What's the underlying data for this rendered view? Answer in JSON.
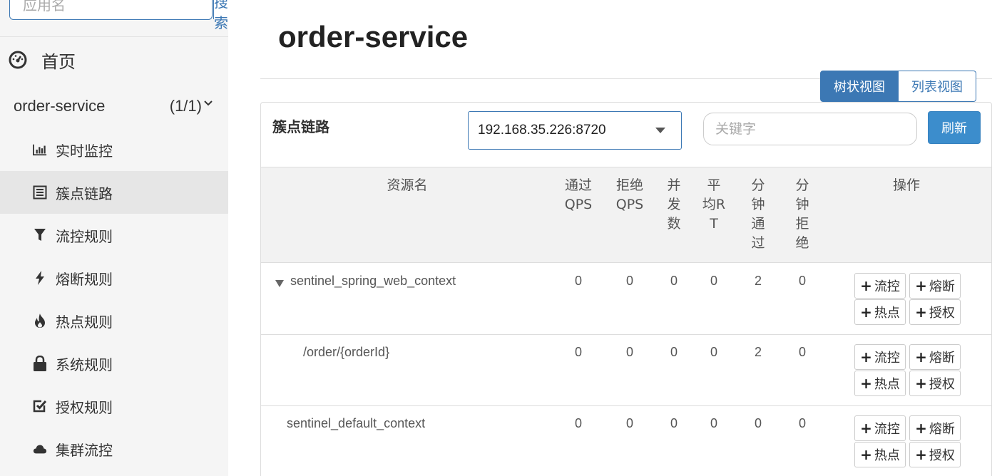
{
  "sidebar": {
    "search_placeholder": "应用名",
    "search_button": "搜索",
    "home_label": "首页",
    "app": {
      "name": "order-service",
      "count": "(1/1)"
    },
    "menu": [
      {
        "label": "实时监控",
        "icon": "bar-chart-icon"
      },
      {
        "label": "簇点链路",
        "icon": "list-icon",
        "active": true
      },
      {
        "label": "流控规则",
        "icon": "filter-icon"
      },
      {
        "label": "熔断规则",
        "icon": "lightning-icon"
      },
      {
        "label": "热点规则",
        "icon": "fire-icon"
      },
      {
        "label": "系统规则",
        "icon": "lock-icon"
      },
      {
        "label": "授权规则",
        "icon": "check-square-icon"
      },
      {
        "label": "集群流控",
        "icon": "cloud-icon"
      }
    ]
  },
  "main": {
    "title": "order-service",
    "view_tree": "树状视图",
    "view_list": "列表视图",
    "panel_title": "簇点链路",
    "machine": "192.168.35.226:8720",
    "keyword_placeholder": "关键字",
    "refresh": "刷新"
  },
  "table": {
    "headers": {
      "resource": "资源名",
      "pass_qps": "通过\nQPS",
      "block_qps": "拒绝\nQPS",
      "threads": "并\n发\n数",
      "avg_rt": "平\n均R\nT",
      "min_pass": "分\n钟\n通\n过",
      "min_block": "分\n钟\n拒\n绝",
      "ops": "操作"
    },
    "rows": [
      {
        "name": "sentinel_spring_web_context",
        "pass_qps": "0",
        "block_qps": "0",
        "threads": "0",
        "avg_rt": "0",
        "min_pass": "2",
        "min_block": "0"
      },
      {
        "name": "/order/{orderId}",
        "pass_qps": "0",
        "block_qps": "0",
        "threads": "0",
        "avg_rt": "0",
        "min_pass": "2",
        "min_block": "0"
      },
      {
        "name": "sentinel_default_context",
        "pass_qps": "0",
        "block_qps": "0",
        "threads": "0",
        "avg_rt": "0",
        "min_pass": "0",
        "min_block": "0"
      }
    ],
    "op_labels": {
      "flow": "流控",
      "degrade": "熔断",
      "param": "热点",
      "auth": "授权"
    }
  },
  "colors": {
    "primary": "#3c78b4",
    "refresh": "#3c8dcc",
    "sidebar_bg": "#f5f5f5",
    "active_item": "#e6e6e6"
  }
}
